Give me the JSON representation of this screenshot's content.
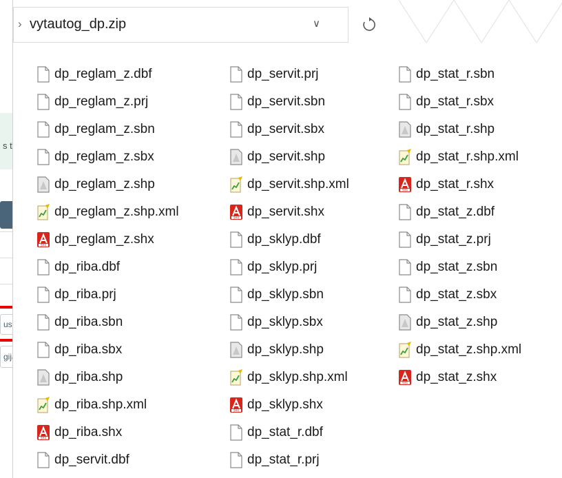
{
  "background_panel": {
    "notice_text": "s test.",
    "field1_text": "us",
    "field2_text": "giją",
    "colors": {
      "notice_bg": "#e9f4ee",
      "button_bg": "#4a6579",
      "highlight": "#e60000"
    }
  },
  "explorer": {
    "path": "vytautog_dp.zip",
    "breadcrumb_icon": "chevron-right-icon",
    "dropdown_icon": "chevron-down-icon",
    "refresh_icon": "refresh-icon",
    "columns": [
      [
        {
          "name": "dp_reglam_z.dbf",
          "icon": "file"
        },
        {
          "name": "dp_reglam_z.prj",
          "icon": "file"
        },
        {
          "name": "dp_reglam_z.sbn",
          "icon": "file"
        },
        {
          "name": "dp_reglam_z.sbx",
          "icon": "file"
        },
        {
          "name": "dp_reglam_z.shp",
          "icon": "shp"
        },
        {
          "name": "dp_reglam_z.shp.xml",
          "icon": "xml"
        },
        {
          "name": "dp_reglam_z.shx",
          "icon": "shx"
        },
        {
          "name": "dp_riba.dbf",
          "icon": "file"
        },
        {
          "name": "dp_riba.prj",
          "icon": "file"
        },
        {
          "name": "dp_riba.sbn",
          "icon": "file"
        },
        {
          "name": "dp_riba.sbx",
          "icon": "file"
        },
        {
          "name": "dp_riba.shp",
          "icon": "shp"
        },
        {
          "name": "dp_riba.shp.xml",
          "icon": "xml"
        },
        {
          "name": "dp_riba.shx",
          "icon": "shx"
        },
        {
          "name": "dp_servit.dbf",
          "icon": "file"
        }
      ],
      [
        {
          "name": "dp_servit.prj",
          "icon": "file"
        },
        {
          "name": "dp_servit.sbn",
          "icon": "file"
        },
        {
          "name": "dp_servit.sbx",
          "icon": "file"
        },
        {
          "name": "dp_servit.shp",
          "icon": "shp"
        },
        {
          "name": "dp_servit.shp.xml",
          "icon": "xml"
        },
        {
          "name": "dp_servit.shx",
          "icon": "shx"
        },
        {
          "name": "dp_sklyp.dbf",
          "icon": "file"
        },
        {
          "name": "dp_sklyp.prj",
          "icon": "file"
        },
        {
          "name": "dp_sklyp.sbn",
          "icon": "file"
        },
        {
          "name": "dp_sklyp.sbx",
          "icon": "file"
        },
        {
          "name": "dp_sklyp.shp",
          "icon": "shp"
        },
        {
          "name": "dp_sklyp.shp.xml",
          "icon": "xml"
        },
        {
          "name": "dp_sklyp.shx",
          "icon": "shx"
        },
        {
          "name": "dp_stat_r.dbf",
          "icon": "file"
        },
        {
          "name": "dp_stat_r.prj",
          "icon": "file"
        }
      ],
      [
        {
          "name": "dp_stat_r.sbn",
          "icon": "file"
        },
        {
          "name": "dp_stat_r.sbx",
          "icon": "file"
        },
        {
          "name": "dp_stat_r.shp",
          "icon": "shp"
        },
        {
          "name": "dp_stat_r.shp.xml",
          "icon": "xml"
        },
        {
          "name": "dp_stat_r.shx",
          "icon": "shx"
        },
        {
          "name": "dp_stat_z.dbf",
          "icon": "file"
        },
        {
          "name": "dp_stat_z.prj",
          "icon": "file"
        },
        {
          "name": "dp_stat_z.sbn",
          "icon": "file"
        },
        {
          "name": "dp_stat_z.sbx",
          "icon": "file"
        },
        {
          "name": "dp_stat_z.shp",
          "icon": "shp"
        },
        {
          "name": "dp_stat_z.shp.xml",
          "icon": "xml"
        },
        {
          "name": "dp_stat_z.shx",
          "icon": "shx"
        }
      ]
    ]
  }
}
